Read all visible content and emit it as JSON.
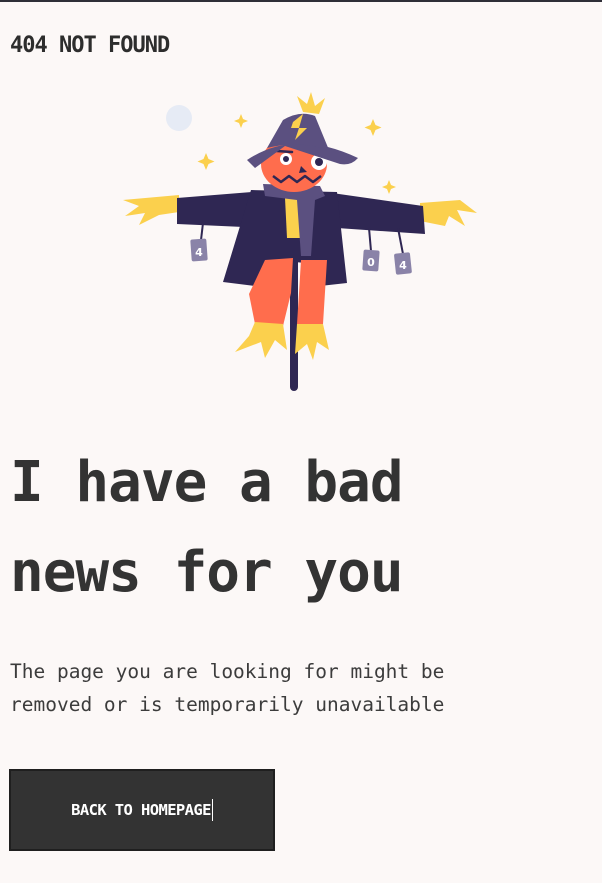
{
  "header": {
    "brand": "404 NOT FOUND"
  },
  "illustration": {
    "name": "scarecrow",
    "sign_left": "4",
    "sign_middle": "0",
    "sign_right": "4"
  },
  "main": {
    "headline_line1": "I have a bad",
    "headline_line2": "news for you",
    "description_line1": "The page you are looking for might be",
    "description_line2": "removed or is temporarily unavailable",
    "button_label": "BACK TO HOMEPAGE"
  },
  "colors": {
    "background": "#fcf8f7",
    "text": "#333333",
    "button": "#333333",
    "coat": "#2f2753",
    "hat": "#5b5080",
    "skin": "#ff6d4d",
    "straw": "#fbd04d",
    "moon": "#e6ebf5"
  }
}
